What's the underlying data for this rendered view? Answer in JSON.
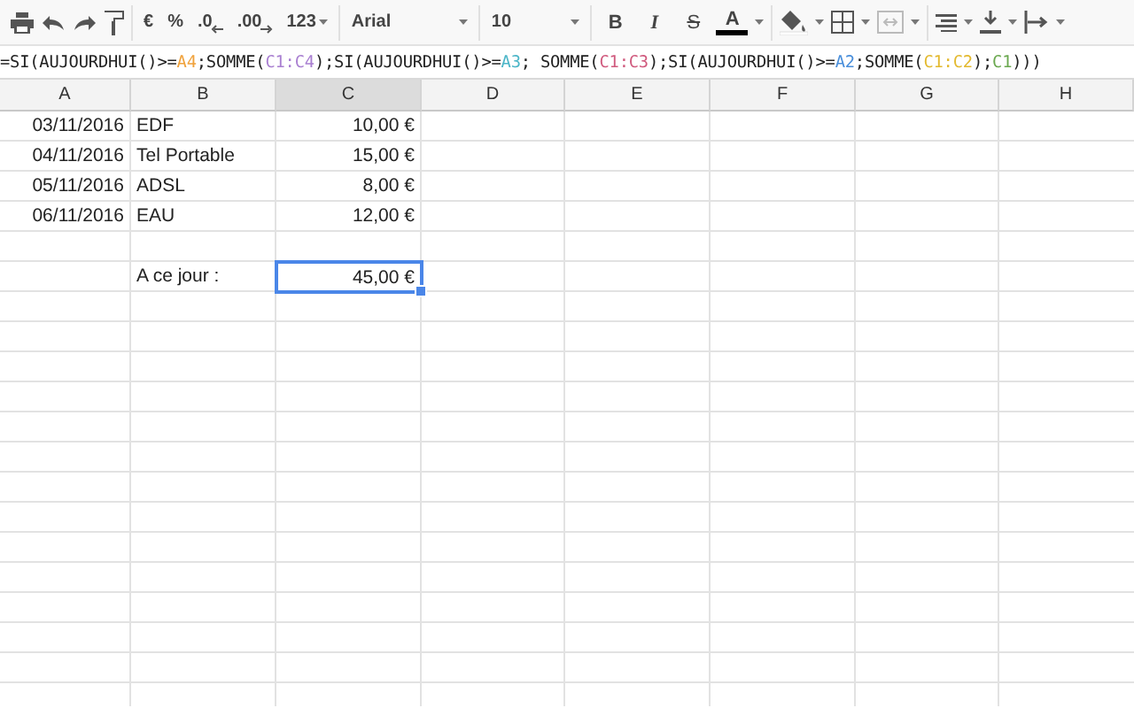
{
  "toolbar": {
    "number_formats": [
      {
        "label": "€",
        "kind": "plain"
      },
      {
        "label": "%",
        "kind": "plain"
      },
      {
        "label": ".0",
        "kind": "decrease"
      },
      {
        "label": ".00",
        "kind": "increase"
      },
      {
        "label": "123",
        "kind": "menu"
      }
    ],
    "font": "Arial",
    "font_size": "10",
    "styles": [
      {
        "label": "B",
        "kind": "bold"
      },
      {
        "label": "I",
        "kind": "italic"
      },
      {
        "label": "S",
        "kind": "strike"
      },
      {
        "label": "A",
        "kind": "color"
      }
    ]
  },
  "formula_bar": {
    "segments": [
      {
        "text": "=SI(AUJOURDHUI()>="
      },
      {
        "text": "A4",
        "color": "#f0a23c"
      },
      {
        "text": ";SOMME("
      },
      {
        "text": "C1:C4",
        "color": "#a97fd1"
      },
      {
        "text": ");SI(AUJOURDHUI()>="
      },
      {
        "text": "A3",
        "color": "#4cb6c8"
      },
      {
        "text": "; SOMME("
      },
      {
        "text": "C1:C3",
        "color": "#d05a7e"
      },
      {
        "text": ");SI(AUJOURDHUI()>="
      },
      {
        "text": "A2",
        "color": "#4a8fdb"
      },
      {
        "text": ";SOMME("
      },
      {
        "text": "C1:C2",
        "color": "#e3b92f"
      },
      {
        "text": ");"
      },
      {
        "text": "C1",
        "color": "#6aa84f"
      },
      {
        "text": ")))"
      }
    ]
  },
  "columns": [
    {
      "label": "A",
      "selected": false
    },
    {
      "label": "B",
      "selected": false
    },
    {
      "label": "C",
      "selected": true
    },
    {
      "label": "D",
      "selected": false
    },
    {
      "label": "E",
      "selected": false
    },
    {
      "label": "F",
      "selected": false
    },
    {
      "label": "G",
      "selected": false
    },
    {
      "label": "H",
      "selected": false
    }
  ],
  "rows": [
    {
      "column_a": {
        "text": "03/11/2016",
        "kind": "number",
        "selected": false
      },
      "column_b": {
        "text": "EDF",
        "kind": "text",
        "selected": false
      },
      "column_c": {
        "text": "10,00 €",
        "kind": "number",
        "selected": false
      }
    },
    {
      "column_a": {
        "text": "04/11/2016",
        "kind": "number",
        "selected": false
      },
      "column_b": {
        "text": "Tel Portable",
        "kind": "text",
        "selected": false
      },
      "column_c": {
        "text": "15,00 €",
        "kind": "number",
        "selected": false
      }
    },
    {
      "column_a": {
        "text": "05/11/2016",
        "kind": "number",
        "selected": false
      },
      "column_b": {
        "text": "ADSL",
        "kind": "text",
        "selected": false
      },
      "column_c": {
        "text": "8,00 €",
        "kind": "number",
        "selected": false
      }
    },
    {
      "column_a": {
        "text": "06/11/2016",
        "kind": "number",
        "selected": false
      },
      "column_b": {
        "text": "EAU",
        "kind": "text",
        "selected": false
      },
      "column_c": {
        "text": "12,00 €",
        "kind": "number",
        "selected": false
      }
    },
    {},
    {
      "column_b": {
        "text": "A ce jour :",
        "kind": "text",
        "selected": false
      },
      "column_c": {
        "text": "45,00 €",
        "kind": "number",
        "selected": true
      }
    }
  ]
}
